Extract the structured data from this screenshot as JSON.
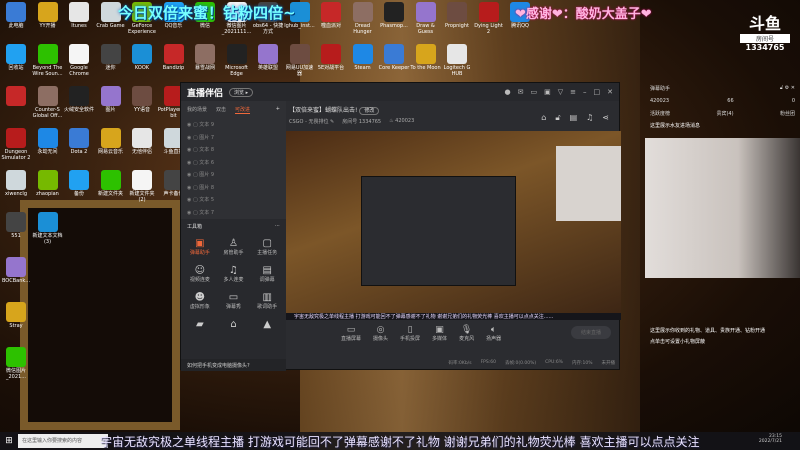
{
  "overlay": {
    "banner": "今日双倍来蜜！钻粉四倍~",
    "thanks": "❤感谢❤：酸奶大盖子❤"
  },
  "douyu": {
    "logo": "斗鱼",
    "room_label": "房间号",
    "room_id": "1334765"
  },
  "desktop_rows": [
    [
      "此电脑",
      "YY开播",
      "Itunes",
      "Crab Game",
      "GeForce Experience",
      "QQ音乐",
      "微信",
      "微信图片_2021111...",
      "obs64 - 快捷方式",
      "lghub_inst...",
      "噬血派对",
      "Dread Hunger",
      "Phasmop...",
      "Draw & Guess",
      "Propnight",
      "Dying Light 2",
      "腾讯QQ"
    ],
    [
      "回收站",
      "Beyond The Wire Soun...",
      "Google Chrome",
      "迷你",
      "KOOK",
      "Bandizip",
      "暴雪战网",
      "Microsoft Edge",
      "英雄联盟",
      "网易UU加速器",
      "5E对战平台",
      "Steam",
      "Core Keeper",
      "To the Moon",
      "Logitech G HUB"
    ],
    [
      "",
      "Counter-S Global Off...",
      "火绒安全软件",
      "图片",
      "YY语音",
      "PotPlayer 64 bit"
    ],
    [
      "Dungeon Simulator 2",
      "永劫无间",
      "Dota 2",
      "网易云音乐",
      "无他伴侣",
      "斗鱼直播"
    ],
    [
      "xiwenclg",
      "zhaopian",
      "备份",
      "新建文件夹",
      "新建文件夹(2)",
      "声卡备份"
    ],
    [
      "551",
      "新建文本文档(3)"
    ],
    [
      "BOCBank..."
    ],
    [
      "Stray"
    ],
    [
      "微信图片_2021..."
    ]
  ],
  "app": {
    "logo": "直播伴侣",
    "badge": "浏览 ▸",
    "tabs": [
      "我的场景",
      "双击",
      "可改进"
    ],
    "sources": [
      "文本 9",
      "图片 7",
      "文本 8",
      "文本 6",
      "图片 9",
      "图片 8",
      "文本 5",
      "文本 7"
    ],
    "toolbox_title": "工具箱",
    "tools": [
      "弹幕助手",
      "房管助手",
      "主播任务",
      "视频连麦",
      "多人连麦",
      "调弹幕",
      "虚拟形象",
      "弹幕秀",
      "歌词助手",
      "",
      "",
      ""
    ],
    "tip": "如何把手机变成电脑摄像头?",
    "stream_title": "【双倍来蜜】蝴蝶队出击!",
    "edit_btn": "修改",
    "game": "CSGO - 无畏排位 ✎",
    "room_info": "房间号 1334765",
    "fans": "♨ 420023",
    "ticker": "宇宙无敌究极之单线程主播 打游戏可能回不了弹幕感谢不了礼物 谢谢兄弟们的礼物荧光棒 喜欢主播可以点点关注......",
    "controls": [
      "直播屏幕",
      "摄像头",
      "手机投屏",
      "多媒体",
      "麦克风",
      "扬声器"
    ],
    "go_live": "结束直播",
    "stats": [
      "码率:0Kb/s",
      "FPS:60",
      "丢帧:0(0.00%)",
      "CPU:6%",
      "内存:10%",
      "未开播"
    ]
  },
  "right_panel": {
    "title": "弹幕助手",
    "likes": "420023",
    "members": "66",
    "gifts": "0",
    "tabs": [
      "活跃度榜",
      "贵宾(4)",
      "粉丝团"
    ],
    "msg1": "这里展示水友进场消息",
    "msg2": "这里展示你收到的礼物、道具、贵族开通、钻粉开通",
    "msg3": "点单击可设置小礼物屏蔽"
  },
  "taskbar": {
    "search": "在这里输入你要搜索的内容",
    "scroll_text": "宇宙无敌究极之单线程主播 打游戏可能回不了弹幕感谢不了礼物 谢谢兄弟们的礼物荧光棒 喜欢主播可以点点关注",
    "time": "23:15",
    "date": "2022/7/21"
  }
}
